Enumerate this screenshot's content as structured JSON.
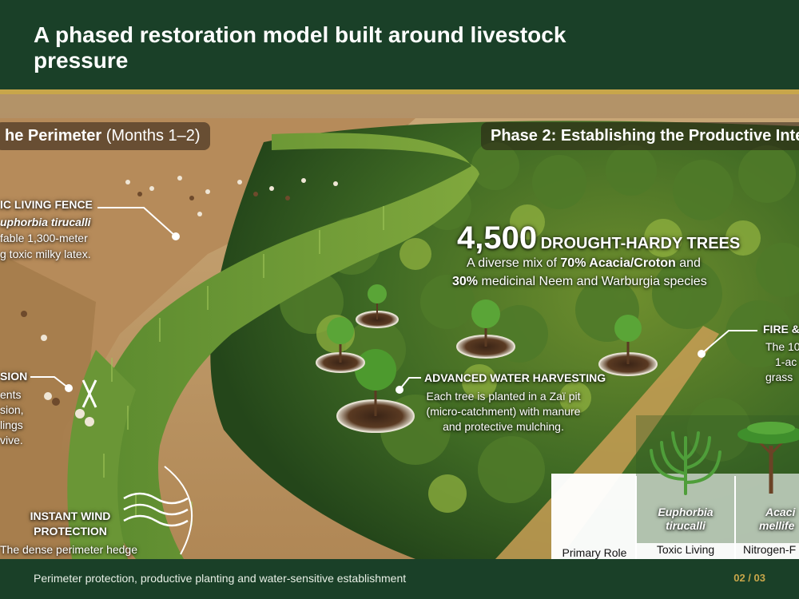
{
  "header": {
    "title": "A phased restoration model built around livestock pressure"
  },
  "phase1": {
    "label_text": "he Perimeter",
    "label_suffix": "(Months 1–2)"
  },
  "phase2": {
    "label": "Phase 2: Establishing the Productive Inte"
  },
  "living_fence": {
    "title": "IC LIVING FENCE",
    "species": "uphorbia tirucalli",
    "line2": "fable 1,300-meter",
    "line3": "g toxic milky latex."
  },
  "erosion": {
    "title": "SION",
    "line1": "ents",
    "line2": "sion,",
    "line3": "lings",
    "line4": "vive."
  },
  "wind": {
    "title_line1": "INSTANT WIND",
    "title_line2": "PROTECTION",
    "body": "The dense perimeter hedge"
  },
  "trees": {
    "count": "4,500",
    "count_label": "DROUGHT-HARDY TREES",
    "line1_prefix": "A diverse mix of",
    "line1_bold": "70% Acacia/Croton",
    "line1_suffix": "and",
    "line2_bold": "30%",
    "line2_suffix": "medicinal Neem and Warburgia species"
  },
  "water": {
    "title": "ADVANCED WATER HARVESTING",
    "line1": "Each tree is planted in a Zaï pit",
    "line2": "(micro-catchment) with manure",
    "line3": "and protective mulching."
  },
  "fire": {
    "title": "FIRE &",
    "line1": "The 10",
    "line2": "1-ac",
    "line3": "grass"
  },
  "table": {
    "col1_line1": "Euphorbia",
    "col1_line2": "tirucalli",
    "col2_line1": "Acaci",
    "col2_line2": "mellife",
    "row_label": "Primary Role",
    "col1_value": "Toxic Living",
    "col2_value": "Nitrogen-F"
  },
  "footer": {
    "caption": "Perimeter protection, productive planting and water-sensitive establishment",
    "page": "02 / 03"
  },
  "colors": {
    "brand_green": "#1a4028",
    "accent_gold": "#c8a64a"
  }
}
